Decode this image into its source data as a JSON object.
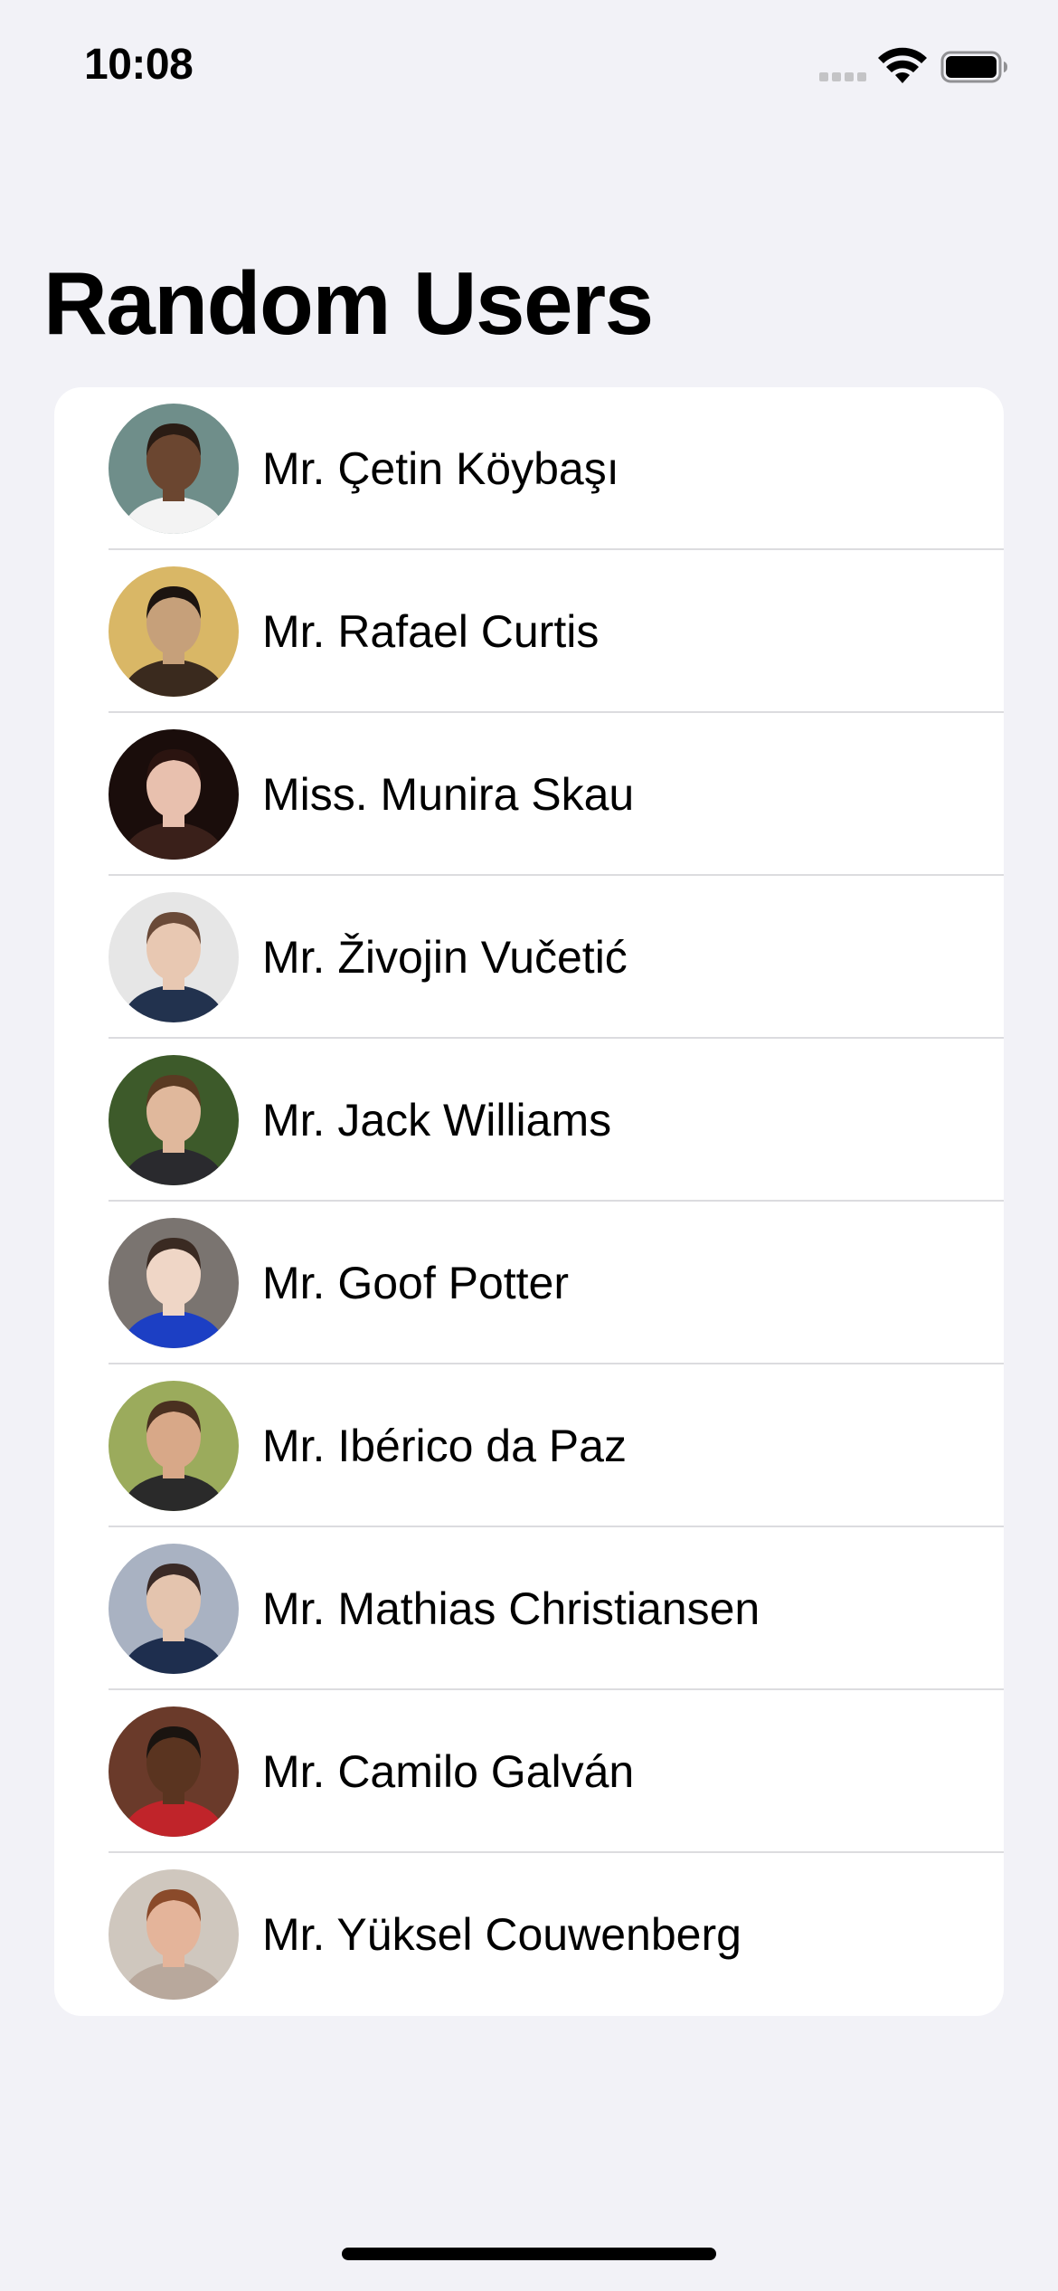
{
  "status_bar": {
    "time": "10:08"
  },
  "page": {
    "title": "Random Users"
  },
  "users": [
    {
      "name": "Mr. Çetin Köybaşı",
      "avatar": "person-avatar",
      "bg": "#6f8e8a",
      "skin": "#6b4630",
      "hair": "#2a1c14",
      "shirt": "#f3f3f3"
    },
    {
      "name": "Mr. Rafael Curtis",
      "avatar": "person-avatar",
      "bg": "#d9b766",
      "skin": "#c6a07a",
      "hair": "#1c1410",
      "shirt": "#3a2a1e"
    },
    {
      "name": "Miss. Munira Skau",
      "avatar": "person-avatar",
      "bg": "#1a0d0b",
      "skin": "#e8c0ae",
      "hair": "#2b1410",
      "shirt": "#3a201a"
    },
    {
      "name": "Mr. Živojin Vučetić",
      "avatar": "person-avatar",
      "bg": "#e6e6e6",
      "skin": "#e8c8b2",
      "hair": "#6a4a38",
      "shirt": "#22324e"
    },
    {
      "name": "Mr. Jack Williams",
      "avatar": "person-avatar",
      "bg": "#3d5a2a",
      "skin": "#e0b89c",
      "hair": "#5a3a22",
      "shirt": "#2a2a2e"
    },
    {
      "name": "Mr. Goof Potter",
      "avatar": "person-avatar",
      "bg": "#7a7470",
      "skin": "#efd6c6",
      "hair": "#3a2a22",
      "shirt": "#1c3fc4"
    },
    {
      "name": "Mr. Ibérico da Paz",
      "avatar": "person-avatar",
      "bg": "#9bab5c",
      "skin": "#d8a888",
      "hair": "#4a3020",
      "shirt": "#2a2a2a"
    },
    {
      "name": "Mr. Mathias Christiansen",
      "avatar": "person-avatar",
      "bg": "#a9b2c2",
      "skin": "#e4c4ae",
      "hair": "#3a2a26",
      "shirt": "#1e2e4e"
    },
    {
      "name": "Mr. Camilo Galván",
      "avatar": "person-avatar",
      "bg": "#6a3a2a",
      "skin": "#5a3420",
      "hair": "#1a1410",
      "shirt": "#c0242a"
    },
    {
      "name": "Mr. Yüksel Couwenberg",
      "avatar": "person-avatar",
      "bg": "#cfc7be",
      "skin": "#e4b49a",
      "hair": "#8a4a2a",
      "shirt": "#b8a89c"
    }
  ],
  "colors": {
    "background": "#f2f2f7",
    "card": "#ffffff",
    "separator": "#dcdcdf",
    "text": "#000000"
  }
}
